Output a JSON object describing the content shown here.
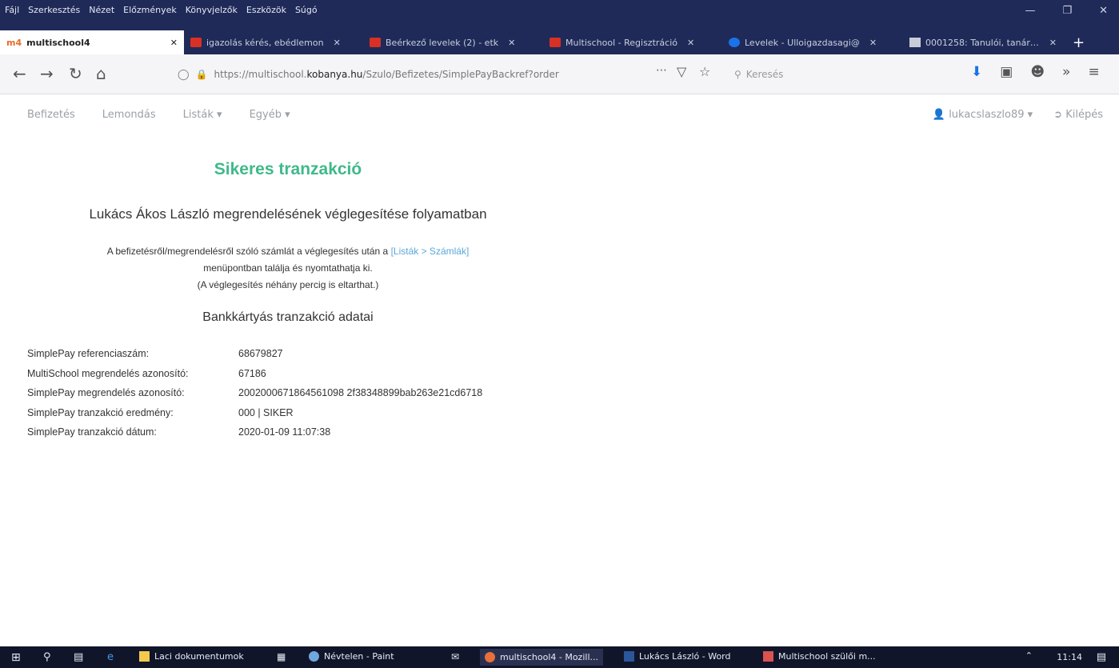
{
  "menu": [
    "Fájl",
    "Szerkesztés",
    "Nézet",
    "Előzmények",
    "Könyvjelzők",
    "Eszközök",
    "Súgó"
  ],
  "tabs": [
    {
      "label": "multischool4",
      "active": true,
      "icon": "multischool-logo-icon"
    },
    {
      "label": "igazolás kérés, ebédlemon",
      "icon": "gmail-icon"
    },
    {
      "label": "Beérkező levelek (2) - etk",
      "icon": "gmail-icon"
    },
    {
      "label": "Multischool - Regisztráció",
      "icon": "gmail-icon"
    },
    {
      "label": "Levelek - Ulloigazdasagi@",
      "icon": "mail-icon"
    },
    {
      "label": "0001258: Tanulói, tanári és",
      "icon": "tracker-icon"
    }
  ],
  "url": {
    "prefix": "https://multischool.",
    "host": "kobanya.hu",
    "path": "/Szulo/Befizetes/SimplePayBackref?order"
  },
  "search_placeholder": "Keresés",
  "sitenav": {
    "left": [
      "Befizetés",
      "Lemondás",
      "Listák ▾",
      "Egyéb ▾"
    ],
    "user": "lukacslaszlo89 ▾",
    "logout": "Kilépés"
  },
  "main": {
    "title": "Sikeres tranzakció",
    "order_heading": "Lukács Ákos László megrendelésének véglegesítése folyamatban",
    "info_line1": "A befizetésről/megrendelésről szóló számlát a véglegesítés után a",
    "info_link": "[Listák > Számlák]",
    "info_line2": "menüpontban találja és nyomtathatja ki.",
    "info_line3": "(A véglegesítés néhány percig is eltarthat.)",
    "bank_heading": "Bankkártyás tranzakció adatai",
    "details": [
      {
        "label": "SimplePay referenciaszám:",
        "value": "68679827"
      },
      {
        "label": "MultiSchool megrendelés azonosító:",
        "value": "67186"
      },
      {
        "label": "SimplePay megrendelés azonosító:",
        "value": "2002000671864561098 2f38348899bab263e21cd6718"
      },
      {
        "label": "SimplePay tranzakció eredmény:",
        "value": "000 | SIKER"
      },
      {
        "label": "SimplePay tranzakció dátum:",
        "value": "2020-01-09 11:07:38"
      }
    ]
  },
  "taskbar": {
    "items": [
      {
        "label": "Laci dokumentumok",
        "color": "#f2c94c"
      },
      {
        "label": "Névtelen - Paint",
        "color": "#6fa8dc"
      },
      {
        "label": "multischool4 - Mozill...",
        "color": "#e8703a"
      },
      {
        "label": "Lukács László - Word",
        "color": "#2b579a"
      },
      {
        "label": "Multischool szülői m...",
        "color": "#d9534f"
      }
    ],
    "clock": "11:14"
  }
}
